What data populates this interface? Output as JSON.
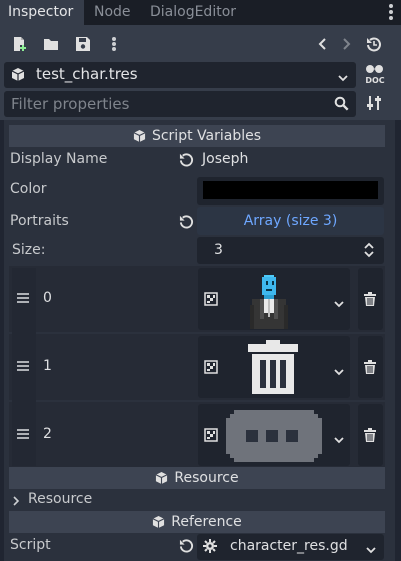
{
  "tabs": [
    {
      "label": "Inspector",
      "active": true
    },
    {
      "label": "Node",
      "active": false
    },
    {
      "label": "DialogEditor",
      "active": false
    }
  ],
  "toolbar": {
    "icons": [
      "new-resource-icon",
      "open-folder-icon",
      "save-icon",
      "more-icon",
      "back-arrow-icon",
      "forward-arrow-icon",
      "history-icon"
    ]
  },
  "resource": {
    "name": "test_char.tres",
    "doc_label": "DOC"
  },
  "filter": {
    "placeholder": "Filter properties"
  },
  "sections": {
    "script_variables": "Script Variables",
    "resource": "Resource",
    "reference": "Reference"
  },
  "properties": {
    "display_name": {
      "label": "Display Name",
      "value": "Joseph"
    },
    "color": {
      "label": "Color",
      "value": "#000000"
    },
    "portraits": {
      "label": "Portraits",
      "value": "Array (size 3)"
    },
    "size": {
      "label": "Size:",
      "value": "3"
    },
    "resource_sub": {
      "label": "Resource"
    },
    "script": {
      "label": "Script",
      "value": "character_res.gd"
    }
  },
  "portrait_items": [
    {
      "index": "0",
      "preview": "joseph-character-sprite"
    },
    {
      "index": "1",
      "preview": "trash-can-sprite"
    },
    {
      "index": "2",
      "preview": "speech-bubble-sprite"
    }
  ],
  "colors": {
    "accent": "#6ea7ff",
    "background": "#202531",
    "panel": "#2b313d",
    "field": "#1f242e"
  }
}
